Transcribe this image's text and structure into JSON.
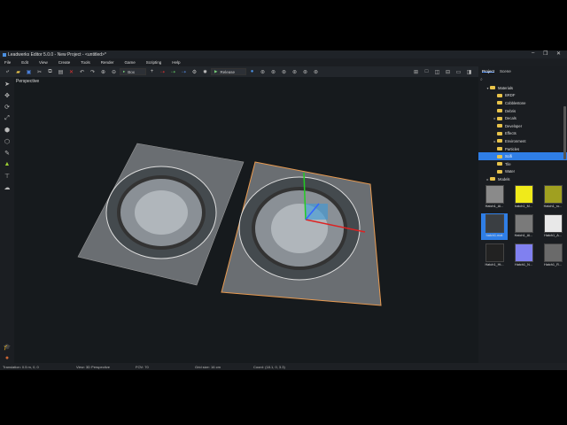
{
  "window": {
    "title": "Leadwerks Editor 5.0.0 - New Project - <untitled>*",
    "controls": [
      "–",
      "❐",
      "✕"
    ]
  },
  "menu": [
    "File",
    "Edit",
    "View",
    "Create",
    "Tools",
    "Render",
    "Game",
    "Scripting",
    "Help"
  ],
  "toolbar": {
    "snap_mode": "Box",
    "run_target": "Release"
  },
  "viewport": {
    "label": "Perspective"
  },
  "panel": {
    "tabs": [
      "Project",
      "Scene"
    ],
    "search_placeholder": "⌕",
    "tree": [
      {
        "label": "Materials",
        "depth": 0,
        "arrow": "▾"
      },
      {
        "label": "BRDF",
        "depth": 1,
        "arrow": ""
      },
      {
        "label": "Cobblestone",
        "depth": 1,
        "arrow": ""
      },
      {
        "label": "Debris",
        "depth": 1,
        "arrow": ""
      },
      {
        "label": "Decals",
        "depth": 1,
        "arrow": "▸"
      },
      {
        "label": "Developer",
        "depth": 1,
        "arrow": ""
      },
      {
        "label": "Effects",
        "depth": 1,
        "arrow": ""
      },
      {
        "label": "Environment",
        "depth": 1,
        "arrow": "▸"
      },
      {
        "label": "Particles",
        "depth": 1,
        "arrow": ""
      },
      {
        "label": "Scifi",
        "depth": 1,
        "arrow": "",
        "selected": true
      },
      {
        "label": "Tile",
        "depth": 1,
        "arrow": ""
      },
      {
        "label": "Water",
        "depth": 1,
        "arrow": ""
      },
      {
        "label": "Models",
        "depth": 0,
        "arrow": "▸"
      }
    ],
    "assets": [
      {
        "label": "Hatch1_Al...",
        "color": "#8a8a8a"
      },
      {
        "label": "hatch1_M...",
        "color": "#f0ea1a"
      },
      {
        "label": "Hatch1_ro...",
        "color": "#a0a020"
      },
      {
        "label": "hatch1.mat",
        "color": "#3a3e42",
        "selected": true
      },
      {
        "label": "Hatch1_Al...",
        "color": "#7a7a7a"
      },
      {
        "label": "Hatch1_A...",
        "color": "#e8e8e8"
      },
      {
        "label": "Hatch1_Ht...",
        "color": "#222222"
      },
      {
        "label": "Hatch1_N...",
        "color": "#8080f0"
      },
      {
        "label": "Hatch1_R...",
        "color": "#6a6a6a"
      }
    ]
  },
  "status": {
    "translation": "Translation: 0.5 m, 0, 0",
    "view": "View: 3D Perspective",
    "fov": "FOV: 70",
    "grid": "Grid size: 16 cm",
    "coord": "Coord: (18.1, 0, 3.3)"
  }
}
